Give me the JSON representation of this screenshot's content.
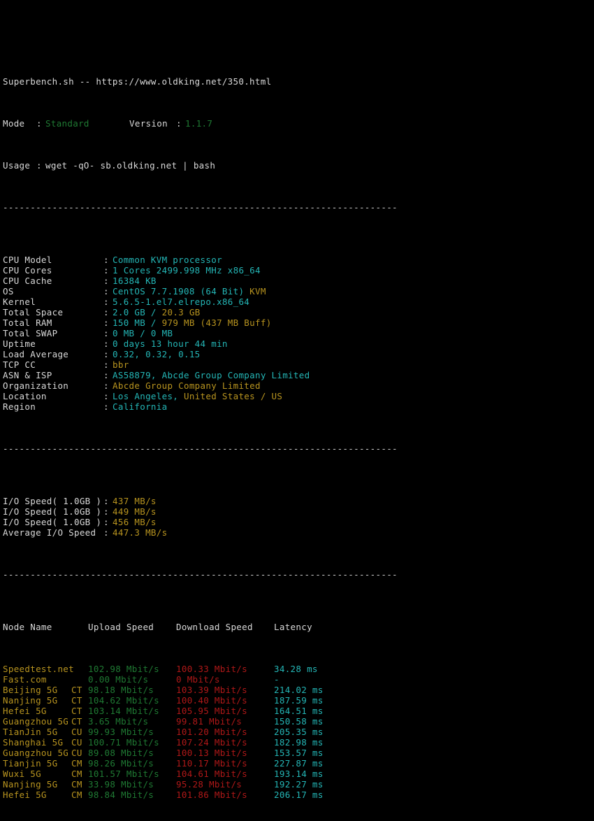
{
  "header": {
    "title": "Superbench.sh -- https://www.oldking.net/350.html",
    "mode_label": "Mode",
    "mode_value": "Standard",
    "version_label": "Version",
    "version_value": "1.1.7",
    "usage_label": "Usage",
    "usage_value": "wget -qO- sb.oldking.net | bash",
    "colon": ":"
  },
  "separator": "------------------------------------------------------------------------",
  "sysinfo": [
    {
      "label": "CPU Model",
      "value": "Common KVM processor",
      "value2": "",
      "color": "cyan"
    },
    {
      "label": "CPU Cores",
      "value": "1 Cores 2499.998 MHz x86_64",
      "value2": "",
      "color": "cyan"
    },
    {
      "label": "CPU Cache",
      "value": "16384 KB",
      "value2": "",
      "color": "cyan"
    },
    {
      "label": "OS",
      "value": "CentOS 7.7.1908 (64 Bit)",
      "value2": " KVM",
      "color": "cyan"
    },
    {
      "label": "Kernel",
      "value": "5.6.5-1.el7.elrepo.x86_64",
      "value2": "",
      "color": "cyan"
    },
    {
      "label": "Total Space",
      "value": "2.0 GB / ",
      "value2": "20.3 GB",
      "color": "cyan"
    },
    {
      "label": "Total RAM",
      "value": "150 MB / ",
      "value2": "979 MB (437 MB Buff)",
      "color": "cyan"
    },
    {
      "label": "Total SWAP",
      "value": "0 MB / 0 MB",
      "value2": "",
      "color": "cyan"
    },
    {
      "label": "Uptime",
      "value": "0 days 13 hour 44 min",
      "value2": "",
      "color": "cyan"
    },
    {
      "label": "Load Average",
      "value": "0.32, 0.32, 0.15",
      "value2": "",
      "color": "cyan"
    },
    {
      "label": "TCP CC",
      "value": "",
      "value2": "bbr",
      "color": "yellow"
    },
    {
      "label": "ASN & ISP",
      "value": "AS58879, Abcde Group Company Limited",
      "value2": "",
      "color": "cyan"
    },
    {
      "label": "Organization",
      "value": "",
      "value2": "Abcde Group Company Limited",
      "color": "yellow"
    },
    {
      "label": "Location",
      "value": "Los Angeles, ",
      "value2": "United States / US",
      "color": "cyan"
    },
    {
      "label": "Region",
      "value": "California",
      "value2": "",
      "color": "cyan"
    }
  ],
  "io": {
    "rows": [
      {
        "label": "I/O Speed( 1.0GB )",
        "value": "437 MB/s"
      },
      {
        "label": "I/O Speed( 1.0GB )",
        "value": "449 MB/s"
      },
      {
        "label": "I/O Speed( 1.0GB )",
        "value": "456 MB/s"
      },
      {
        "label": "Average I/O Speed",
        "value": "447.3 MB/s"
      }
    ]
  },
  "speedtest": {
    "headers": {
      "node": "Node Name",
      "upload": "Upload Speed",
      "download": "Download Speed",
      "latency": "Latency"
    },
    "rows": [
      {
        "node": "Speedtest.net",
        "carrier": "",
        "upload": "102.98 Mbit/s",
        "download": "100.33 Mbit/s",
        "latency": "34.28 ms"
      },
      {
        "node": "Fast.com",
        "carrier": "",
        "upload": "0.00 Mbit/s",
        "download": "0 Mbit/s",
        "latency": "-"
      },
      {
        "node": "Beijing 5G",
        "carrier": "CT",
        "upload": "98.18 Mbit/s",
        "download": "103.39 Mbit/s",
        "latency": "214.02 ms"
      },
      {
        "node": "Nanjing 5G",
        "carrier": "CT",
        "upload": "104.62 Mbit/s",
        "download": "100.40 Mbit/s",
        "latency": "187.59 ms"
      },
      {
        "node": "Hefei 5G",
        "carrier": "CT",
        "upload": "103.14 Mbit/s",
        "download": "105.95 Mbit/s",
        "latency": "164.51 ms"
      },
      {
        "node": "Guangzhou 5G",
        "carrier": "CT",
        "upload": "3.65 Mbit/s",
        "download": "99.81 Mbit/s",
        "latency": "150.58 ms"
      },
      {
        "node": "TianJin 5G",
        "carrier": "CU",
        "upload": "99.93 Mbit/s",
        "download": "101.20 Mbit/s",
        "latency": "205.35 ms"
      },
      {
        "node": "Shanghai 5G",
        "carrier": "CU",
        "upload": "100.71 Mbit/s",
        "download": "107.24 Mbit/s",
        "latency": "182.98 ms"
      },
      {
        "node": "Guangzhou 5G",
        "carrier": "CU",
        "upload": "89.08 Mbit/s",
        "download": "100.13 Mbit/s",
        "latency": "153.57 ms"
      },
      {
        "node": "Tianjin 5G",
        "carrier": "CM",
        "upload": "98.26 Mbit/s",
        "download": "110.17 Mbit/s",
        "latency": "227.87 ms"
      },
      {
        "node": "Wuxi 5G",
        "carrier": "CM",
        "upload": "101.57 Mbit/s",
        "download": "104.61 Mbit/s",
        "latency": "193.14 ms"
      },
      {
        "node": "Nanjing 5G",
        "carrier": "CM",
        "upload": "33.98 Mbit/s",
        "download": "95.28 Mbit/s",
        "latency": "192.27 ms"
      },
      {
        "node": "Hefei 5G",
        "carrier": "CM",
        "upload": "98.84 Mbit/s",
        "download": "101.86 Mbit/s",
        "latency": "206.17 ms"
      }
    ]
  },
  "colors": {
    "background": "#000000",
    "text": "#d9d9d9",
    "cyan": "#24b6b6",
    "green": "#1f7a33",
    "yellow": "#b8941f",
    "red": "#b01818"
  }
}
